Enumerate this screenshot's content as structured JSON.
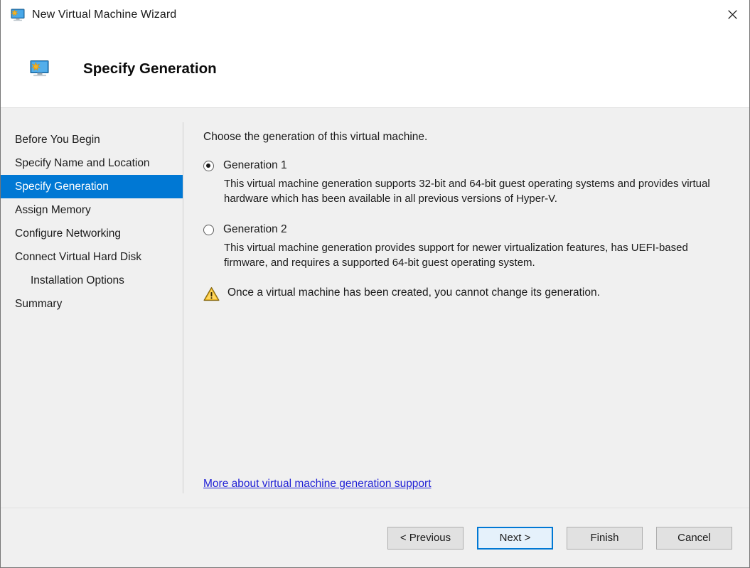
{
  "window": {
    "title": "New Virtual Machine Wizard",
    "title_icon": "virtual-machine-icon",
    "close_label": "×"
  },
  "header": {
    "icon": "virtual-machine-icon",
    "title": "Specify Generation"
  },
  "sidebar": {
    "items": [
      {
        "label": "Before You Begin",
        "selected": false,
        "indent": false
      },
      {
        "label": "Specify Name and Location",
        "selected": false,
        "indent": false
      },
      {
        "label": "Specify Generation",
        "selected": true,
        "indent": false
      },
      {
        "label": "Assign Memory",
        "selected": false,
        "indent": false
      },
      {
        "label": "Configure Networking",
        "selected": false,
        "indent": false
      },
      {
        "label": "Connect Virtual Hard Disk",
        "selected": false,
        "indent": false
      },
      {
        "label": "Installation Options",
        "selected": false,
        "indent": true
      },
      {
        "label": "Summary",
        "selected": false,
        "indent": false
      }
    ]
  },
  "content": {
    "intro": "Choose the generation of this virtual machine.",
    "options": [
      {
        "label": "Generation 1",
        "selected": true,
        "description": "This virtual machine generation supports 32-bit and 64-bit guest operating systems and provides virtual hardware which has been available in all previous versions of Hyper-V."
      },
      {
        "label": "Generation 2",
        "selected": false,
        "description": "This virtual machine generation provides support for newer virtualization features, has UEFI-based firmware, and requires a supported 64-bit guest operating system."
      }
    ],
    "warning": {
      "icon": "warning-triangle-icon",
      "text": "Once a virtual machine has been created, you cannot change its generation."
    },
    "link": {
      "label": "More about virtual machine generation support",
      "color": "#1f1fd6"
    }
  },
  "footer": {
    "buttons": [
      {
        "label": "< Previous",
        "default": false
      },
      {
        "label": "Next >",
        "default": true
      },
      {
        "label": "Finish",
        "default": false
      },
      {
        "label": "Cancel",
        "default": false
      }
    ]
  },
  "colors": {
    "accent": "#0078d4",
    "surface": "#f0f0f0",
    "link": "#1f1fd6",
    "warning": "#ffc425"
  }
}
